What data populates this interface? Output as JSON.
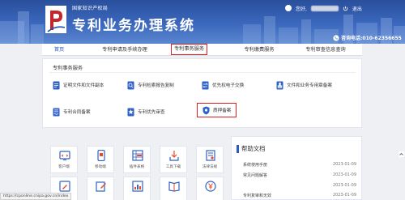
{
  "header": {
    "office_name": "国家知识产权局",
    "system_title": "专利业务办理系统",
    "user_label": "您好,",
    "exit_label": "退出",
    "hotline": "咨询电话:010-62356655",
    "bg_color": "#3b68bd"
  },
  "nav": {
    "items": [
      {
        "label": "首页"
      },
      {
        "label": "专利申请及手续办理"
      },
      {
        "label": "专利事务服务"
      },
      {
        "label": "专利缴费服务"
      },
      {
        "label": "专利审查信息查询"
      }
    ],
    "active_color": "#2a5bc0",
    "highlight_color": "#e02020"
  },
  "panel": {
    "title": "专利事务服务",
    "services": [
      {
        "label": "证明文件和文件副本",
        "icon": "document-copy-icon"
      },
      {
        "label": "专利检索报告复制",
        "icon": "report-icon"
      },
      {
        "label": "优先权电子交换",
        "icon": "exchange-icon"
      },
      {
        "label": "文件和业务专用章备案",
        "icon": "stamp-icon"
      },
      {
        "label": "专利合同备案",
        "icon": "contract-icon"
      },
      {
        "label": "专利优先审查",
        "icon": "priority-icon"
      },
      {
        "label": "质押备案",
        "icon": "pledge-shield-icon"
      }
    ]
  },
  "tiles": [
    {
      "label": "客户端",
      "icon": "client-icon"
    },
    {
      "label": "移动端",
      "icon": "mobile-icon"
    },
    {
      "label": "插件表格",
      "icon": "plugin-table-icon"
    },
    {
      "label": "工具下载",
      "icon": "tool-download-icon"
    },
    {
      "label": "法律法规",
      "icon": "law-icon"
    },
    {
      "label": "",
      "icon": "pen-icon"
    },
    {
      "label": "",
      "icon": "edit-icon"
    },
    {
      "label": "",
      "icon": "chart-icon"
    },
    {
      "label": "",
      "icon": "book-icon"
    },
    {
      "label": "",
      "icon": "yen-icon"
    }
  ],
  "help": {
    "title": "帮助文档",
    "rows": [
      {
        "title": "系统使用手册",
        "date": "2023-01-09"
      },
      {
        "title": "常见问题解答",
        "date": "2023-01-09"
      },
      {
        "title": "",
        "date": "2023-01-09"
      },
      {
        "title": "专利复审和无效",
        "date": "2023-01-09"
      }
    ]
  },
  "status_url": "https://cponline.cnipa.gov.cn/index"
}
